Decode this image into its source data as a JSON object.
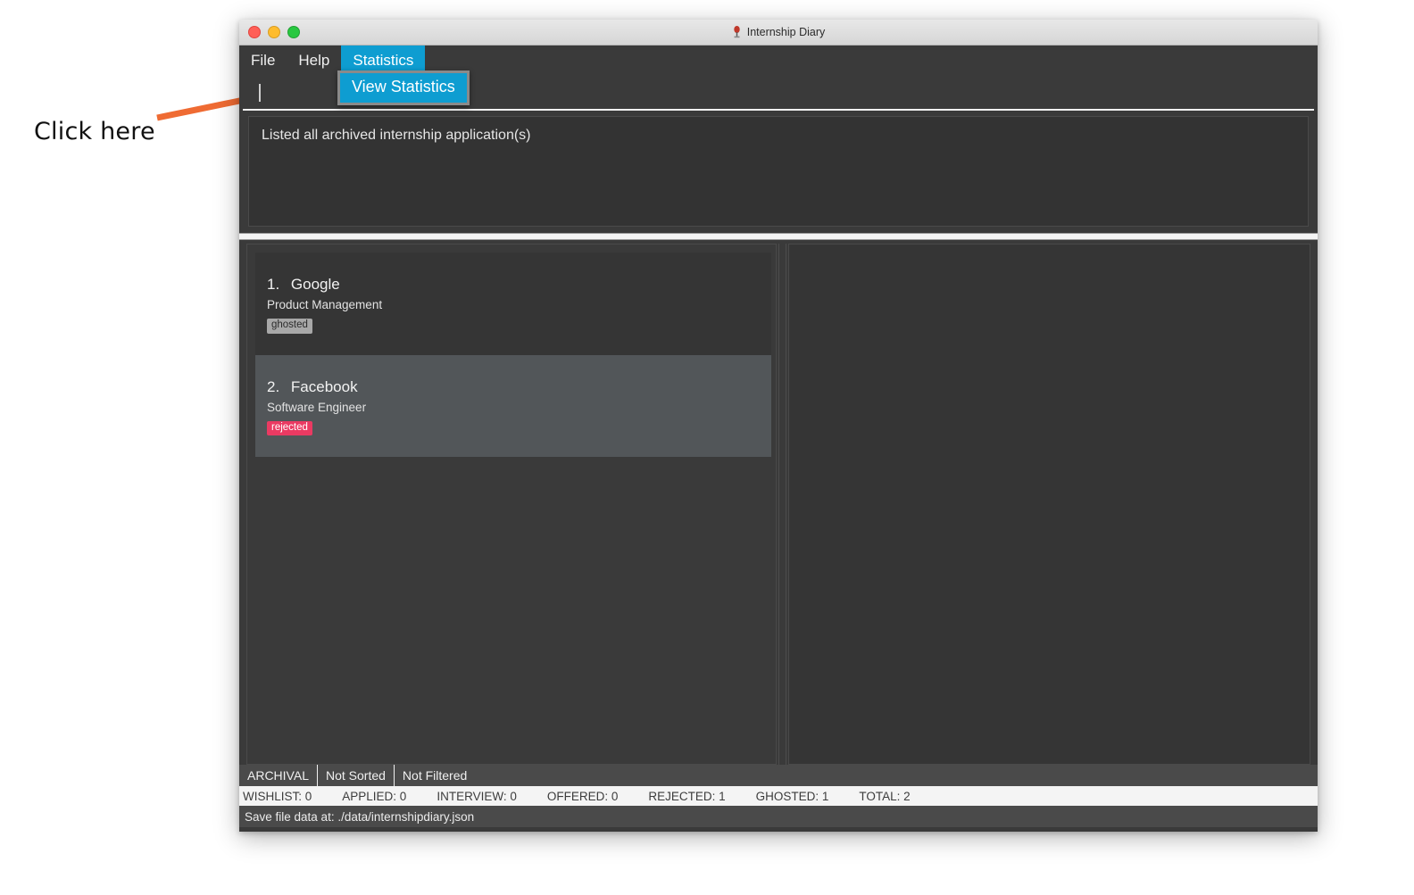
{
  "annotation": {
    "label": "Click here",
    "arrow_color": "#ef6b33",
    "arrow_icon": "arrow-pointing-up-right-icon"
  },
  "window": {
    "title": "Internship Diary",
    "title_icon": "pin-marker-icon",
    "traffic_lights": {
      "close": "close-button",
      "minimize": "minimize-button",
      "maximize": "maximize-button"
    }
  },
  "menubar": {
    "items": [
      {
        "label": "File",
        "active": false
      },
      {
        "label": "Help",
        "active": false
      },
      {
        "label": "Statistics",
        "active": true
      }
    ],
    "accent_color": "#0e9dd1"
  },
  "dropdown": {
    "open": true,
    "items": [
      {
        "label": "View Statistics",
        "highlighted": true
      }
    ]
  },
  "command": {
    "value": "",
    "placeholder": ""
  },
  "message": {
    "text": "Listed all archived internship application(s)"
  },
  "list": {
    "cards": [
      {
        "index": "1.",
        "company": "Google",
        "role": "Product Management",
        "status": "ghosted",
        "status_color": "#a8a8a8",
        "selected": false
      },
      {
        "index": "2.",
        "company": "Facebook",
        "role": "Software Engineer",
        "status": "rejected",
        "status_color": "#ea3a62",
        "selected": true
      }
    ]
  },
  "detail_panel": {
    "content": ""
  },
  "statusbar": {
    "mode": "ARCHIVAL",
    "sort": "Not Sorted",
    "filter": "Not Filtered",
    "counts": [
      "WISHLIST: 0",
      "APPLIED: 0",
      "INTERVIEW: 0",
      "OFFERED: 0",
      "REJECTED: 1",
      "GHOSTED: 1",
      "TOTAL: 2"
    ],
    "save_path": "Save file data at: ./data/internshipdiary.json"
  }
}
